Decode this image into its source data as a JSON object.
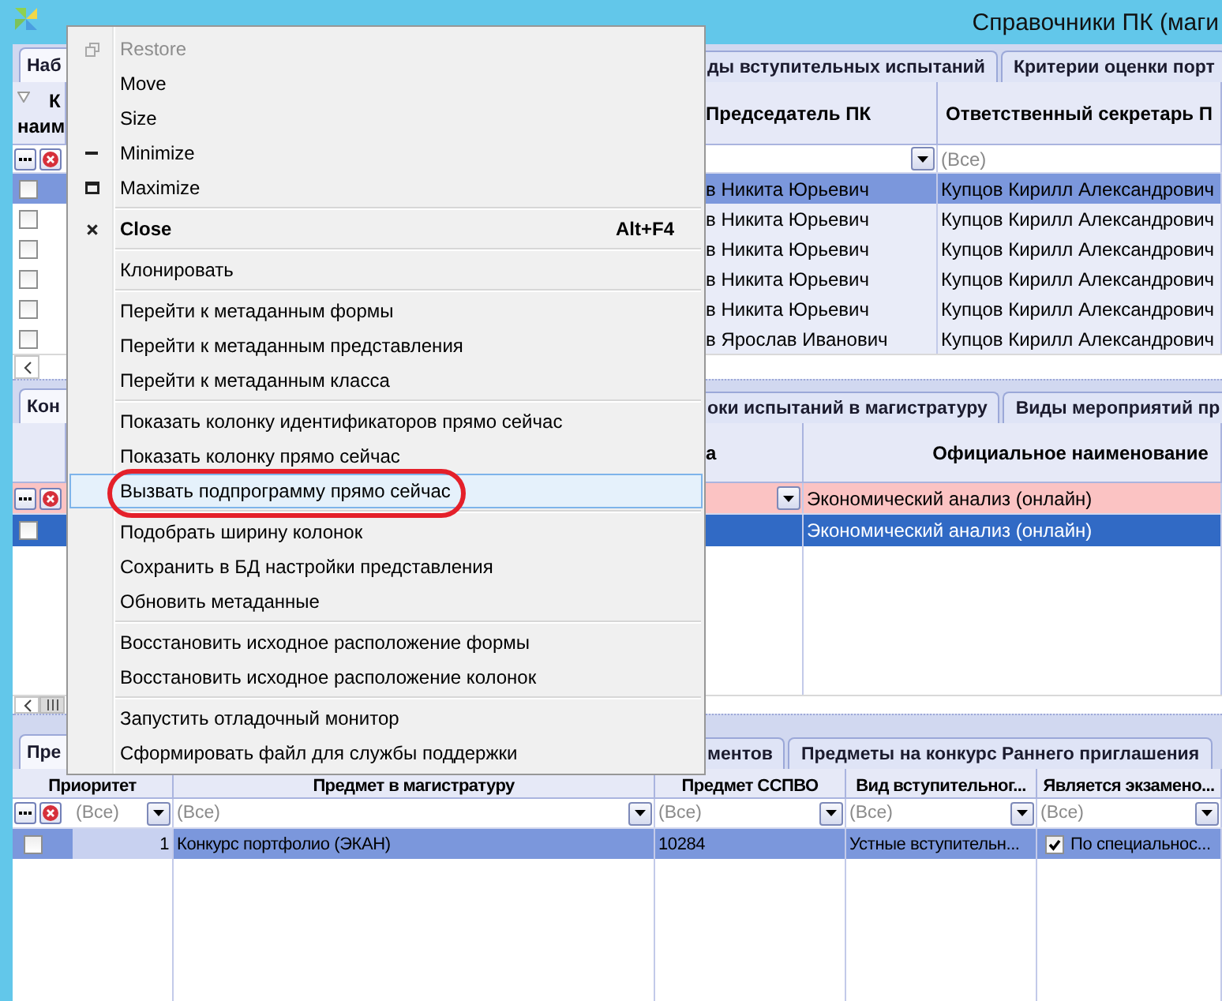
{
  "window": {
    "title": "Справочники ПК (маги"
  },
  "panels": [
    {
      "focused": false,
      "filter_active": false,
      "tabs": [
        {
          "label": "Наб",
          "selected": true
        },
        {
          "label": "ды вступительных испытаний",
          "selected": false
        },
        {
          "label": "Критерии оценки порт",
          "selected": false
        }
      ],
      "lead_header": [
        "К",
        "наим"
      ],
      "columns": [
        {
          "header": "Председатель ПК",
          "filter": {
            "dropdown": true
          }
        },
        {
          "header": "Ответственный секретарь П",
          "filter": {
            "placeholder": "(Все)",
            "dropdown": false
          }
        }
      ],
      "rows": [
        {
          "selected": true,
          "checked": false,
          "cells": [
            {
              "kind": "text",
              "text": "в Никита Юрьевич"
            },
            {
              "kind": "text",
              "text": "Купцов Кирилл Александрович"
            }
          ]
        },
        {
          "selected": false,
          "checked": false,
          "cells": [
            {
              "kind": "text",
              "text": "в Никита Юрьевич"
            },
            {
              "kind": "text",
              "text": "Купцов Кирилл Александрович"
            }
          ]
        },
        {
          "selected": false,
          "checked": false,
          "cells": [
            {
              "kind": "text",
              "text": "в Никита Юрьевич"
            },
            {
              "kind": "text",
              "text": "Купцов Кирилл Александрович"
            }
          ]
        },
        {
          "selected": false,
          "checked": false,
          "cells": [
            {
              "kind": "text",
              "text": "в Никита Юрьевич"
            },
            {
              "kind": "text",
              "text": "Купцов Кирилл Александрович"
            }
          ]
        },
        {
          "selected": false,
          "checked": false,
          "cells": [
            {
              "kind": "text",
              "text": "в Никита Юрьевич"
            },
            {
              "kind": "text",
              "text": "Купцов Кирилл Александрович"
            }
          ]
        },
        {
          "selected": false,
          "checked": false,
          "cells": [
            {
              "kind": "text",
              "text": "в Ярослав Иванович"
            },
            {
              "kind": "text",
              "text": "Купцов Кирилл Александрович"
            }
          ]
        }
      ]
    },
    {
      "focused": true,
      "filter_active": true,
      "tabs": [
        {
          "label": "Кон",
          "selected": true
        },
        {
          "label": "оки испытаний в магистратуру",
          "selected": false
        },
        {
          "label": "Виды мероприятий пр",
          "selected": false
        }
      ],
      "columns": [
        {
          "header": "а",
          "filter": {
            "dropdown": true
          }
        },
        {
          "header": "Официальное наименование",
          "filter": {
            "value": "Экономический анализ (онлайн)",
            "dropdown": false
          }
        }
      ],
      "rows": [
        {
          "selected": true,
          "checked": false,
          "cells": [
            {
              "kind": "blank"
            },
            {
              "kind": "text",
              "text": "Экономический анализ (онлайн)"
            }
          ]
        }
      ]
    },
    {
      "focused": false,
      "filter_active": false,
      "tabs": [
        {
          "label": "Пре",
          "selected": true
        },
        {
          "label": "ментов",
          "selected": false
        },
        {
          "label": "Предметы на конкурс Раннего приглашения",
          "selected": false
        }
      ],
      "columns": [
        {
          "header": "Приоритет",
          "filter": {
            "placeholder": "(Все)",
            "dropdown": true
          }
        },
        {
          "header": "Предмет в магистратуру",
          "filter": {
            "placeholder": "(Все)",
            "dropdown": true
          }
        },
        {
          "header": "Предмет ССПВО",
          "filter": {
            "placeholder": "(Все)",
            "dropdown": true
          }
        },
        {
          "header": "Вид вступительног...",
          "filter": {
            "placeholder": "(Все)",
            "dropdown": true
          }
        },
        {
          "header": "Является экзамено...",
          "filter": {
            "placeholder": "(Все)",
            "dropdown": true
          }
        }
      ],
      "rows": [
        {
          "selected": true,
          "checked": false,
          "cells": [
            {
              "kind": "number",
              "text": "1",
              "current": true
            },
            {
              "kind": "text",
              "text": "Конкурс портфолио (ЭКАН)",
              "current": false
            },
            {
              "kind": "text",
              "text": "10284",
              "current": false
            },
            {
              "kind": "text",
              "text": "Устные вступительн...",
              "current": false
            },
            {
              "kind": "check",
              "checked": true,
              "text": "По специальнос...",
              "current": false
            }
          ]
        }
      ]
    }
  ],
  "context_menu": {
    "items": [
      {
        "kind": "item",
        "label": "Restore",
        "disabled": true,
        "default": false,
        "selected": false
      },
      {
        "kind": "item",
        "label": "Move",
        "disabled": false,
        "default": false,
        "selected": false
      },
      {
        "kind": "item",
        "label": "Size",
        "disabled": false,
        "default": false,
        "selected": false
      },
      {
        "kind": "item",
        "label": "Minimize",
        "disabled": false,
        "default": false,
        "selected": false
      },
      {
        "kind": "item",
        "label": "Maximize",
        "disabled": false,
        "default": false,
        "selected": false
      },
      {
        "kind": "separator"
      },
      {
        "kind": "item",
        "label": "Close",
        "shortcut": "Alt+F4",
        "disabled": false,
        "default": true,
        "selected": false
      },
      {
        "kind": "separator"
      },
      {
        "kind": "item",
        "label": "Клонировать",
        "disabled": false,
        "default": false,
        "selected": false
      },
      {
        "kind": "separator"
      },
      {
        "kind": "item",
        "label": "Перейти к метаданным формы",
        "disabled": false,
        "default": false,
        "selected": false
      },
      {
        "kind": "item",
        "label": "Перейти к метаданным представления",
        "disabled": false,
        "default": false,
        "selected": false
      },
      {
        "kind": "item",
        "label": "Перейти к метаданным класса",
        "disabled": false,
        "default": false,
        "selected": false
      },
      {
        "kind": "separator"
      },
      {
        "kind": "item",
        "label": "Показать колонку идентификаторов прямо сейчас",
        "disabled": false,
        "default": false,
        "selected": false
      },
      {
        "kind": "item",
        "label": "Показать колонку прямо сейчас",
        "disabled": false,
        "default": false,
        "selected": false
      },
      {
        "kind": "item",
        "label": "Вызвать подпрограмму прямо сейчас",
        "disabled": false,
        "default": false,
        "selected": true
      },
      {
        "kind": "separator"
      },
      {
        "kind": "item",
        "label": "Подобрать ширину колонок",
        "disabled": false,
        "default": false,
        "selected": false
      },
      {
        "kind": "item",
        "label": "Сохранить в БД настройки представления",
        "disabled": false,
        "default": false,
        "selected": false
      },
      {
        "kind": "item",
        "label": "Обновить метаданные",
        "disabled": false,
        "default": false,
        "selected": false
      },
      {
        "kind": "separator"
      },
      {
        "kind": "item",
        "label": "Восстановить исходное расположение формы",
        "disabled": false,
        "default": false,
        "selected": false
      },
      {
        "kind": "item",
        "label": "Восстановить исходное расположение колонок",
        "disabled": false,
        "default": false,
        "selected": false
      },
      {
        "kind": "separator"
      },
      {
        "kind": "item",
        "label": "Запустить отладочный монитор",
        "disabled": false,
        "default": false,
        "selected": false
      },
      {
        "kind": "item",
        "label": "Сформировать файл для службы поддержки",
        "disabled": false,
        "default": false,
        "selected": false
      }
    ]
  }
}
